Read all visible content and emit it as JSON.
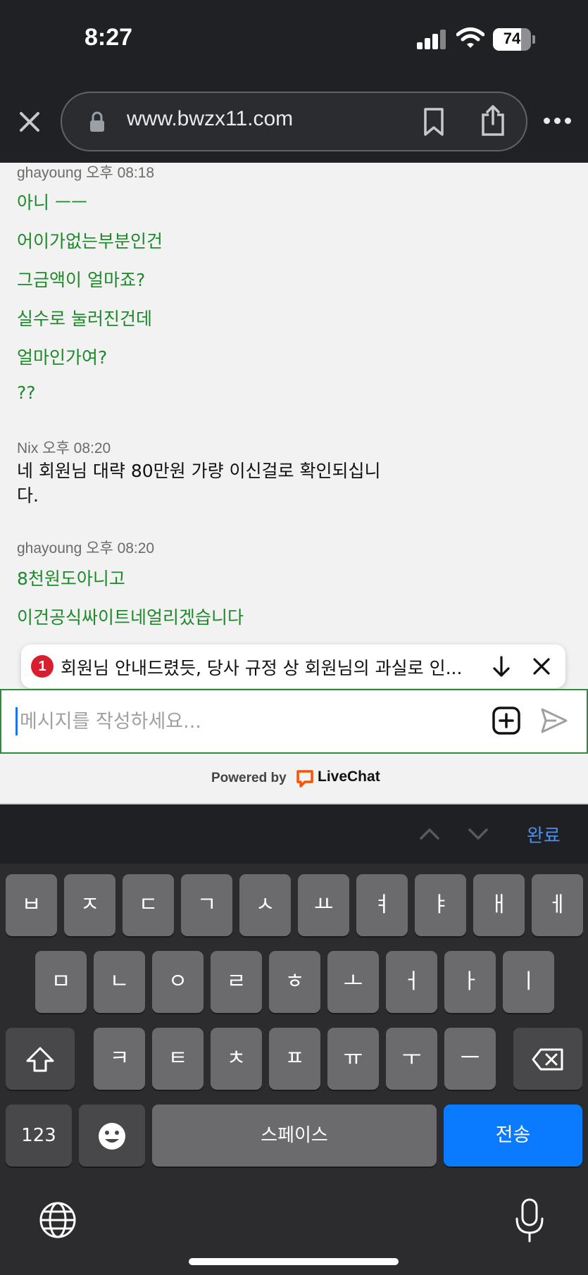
{
  "status": {
    "time": "8:27",
    "battery": "74",
    "battery_percent": 74
  },
  "browser": {
    "url": "www.bwzx11.com"
  },
  "messages": [
    {
      "author": "ghayoung 오후 08:18",
      "lines": [
        "아니 ㅡㅡ",
        "어이가없는부분인건",
        "그금액이 얼마죠?",
        "실수로 눌러진건데",
        "얼마인가여?",
        "??"
      ]
    },
    {
      "author": "Nix 오후 08:20",
      "lines": [
        "네 회원님 대략 80만원 가량 이신걸로 확인되십니",
        "다."
      ]
    },
    {
      "author": "ghayoung 오후 08:20",
      "lines": [
        "8천원도아니고",
        "이건공식싸이트네얼리겠습니다"
      ]
    }
  ],
  "banner": {
    "count": "1",
    "text": "회원님 안내드렸듯, 당사 규정 상 회원님의 과실로 인..."
  },
  "input": {
    "placeholder": "메시지를 작성하세요..."
  },
  "powered": {
    "label": "Powered by",
    "brand": "LiveChat",
    "brand_color": "#ff5100"
  },
  "keyboard": {
    "done": "완료",
    "row1": [
      "ㅂ",
      "ㅈ",
      "ㄷ",
      "ㄱ",
      "ㅅ",
      "ㅛ",
      "ㅕ",
      "ㅑ",
      "ㅐ",
      "ㅔ"
    ],
    "row2": [
      "ㅁ",
      "ㄴ",
      "ㅇ",
      "ㄹ",
      "ㅎ",
      "ㅗ",
      "ㅓ",
      "ㅏ",
      "ㅣ"
    ],
    "row3": [
      "ㅋ",
      "ㅌ",
      "ㅊ",
      "ㅍ",
      "ㅠ",
      "ㅜ",
      "ㅡ"
    ],
    "numbers": "123",
    "space": "스페이스",
    "send": "전송"
  },
  "colors": {
    "accent_green": "#1d8a2a",
    "send_blue": "#0a7aff",
    "badge_red": "#d6202f"
  }
}
